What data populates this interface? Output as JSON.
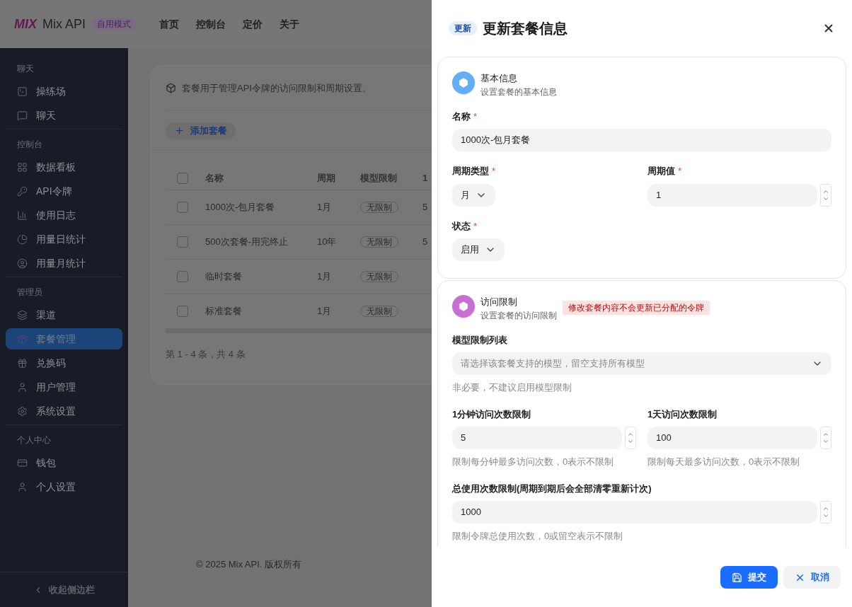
{
  "header": {
    "logo": "MIX",
    "brand": "Mix API",
    "mode_badge": "自用模式",
    "nav": [
      "首页",
      "控制台",
      "定价",
      "关于"
    ]
  },
  "sidebar": {
    "sections": [
      {
        "title": "聊天",
        "items": [
          {
            "label": "操练场",
            "selected": false
          },
          {
            "label": "聊天",
            "selected": false
          }
        ]
      },
      {
        "title": "控制台",
        "items": [
          {
            "label": "数据看板",
            "selected": false
          },
          {
            "label": "API令牌",
            "selected": false
          },
          {
            "label": "使用日志",
            "selected": false
          },
          {
            "label": "用量日统计",
            "selected": false
          },
          {
            "label": "用量月统计",
            "selected": false
          }
        ]
      },
      {
        "title": "管理员",
        "items": [
          {
            "label": "渠道",
            "selected": false
          },
          {
            "label": "套餐管理",
            "selected": true
          },
          {
            "label": "兑换码",
            "selected": false
          },
          {
            "label": "用户管理",
            "selected": false
          },
          {
            "label": "系统设置",
            "selected": false
          }
        ]
      },
      {
        "title": "个人中心",
        "items": [
          {
            "label": "钱包",
            "selected": false
          },
          {
            "label": "个人设置",
            "selected": false
          }
        ]
      }
    ],
    "collapse": "收起侧边栏"
  },
  "main": {
    "notice": "套餐用于管理API令牌的访问限制和周期设置。",
    "add_button": "添加套餐",
    "table": {
      "all_checked": false,
      "columns": [
        "名称",
        "周期",
        "模型限制",
        "1"
      ],
      "rows": [
        {
          "checked": false,
          "cells": [
            "1000次-包月套餐",
            "1月",
            "无限制",
            "5"
          ]
        },
        {
          "checked": false,
          "cells": [
            "500次套餐-用完终止",
            "10年",
            "无限制",
            "5"
          ]
        },
        {
          "checked": false,
          "cells": [
            "临时套餐",
            "1月",
            "无限制"
          ]
        },
        {
          "checked": false,
          "cells": [
            "标准套餐",
            "1月",
            "无限制"
          ]
        }
      ]
    },
    "pagination": "第 1 - 4 条，共 4 条"
  },
  "footer": "© 2025 Mix API. 版权所有",
  "drawer": {
    "required_mark": "*",
    "tag": "更新",
    "title": "更新套餐信息",
    "sections": [
      {
        "title": "基本信息",
        "subtitle": "设置套餐的基本信息",
        "color": "#64aef5",
        "rows": [
          [
            {
              "kind": "text",
              "label": "名称",
              "required": true,
              "value": "1000次-包月套餐"
            }
          ],
          [
            {
              "kind": "select",
              "label": "周期类型",
              "required": true,
              "value": "月"
            },
            {
              "kind": "number",
              "label": "周期值",
              "required": true,
              "value": "1"
            }
          ],
          [
            {
              "kind": "select",
              "label": "状态",
              "required": true,
              "value": "启用"
            }
          ]
        ]
      },
      {
        "title": "访问限制",
        "subtitle": "设置套餐的访问限制",
        "color": "#c86fd2",
        "warning": "修改套餐内容不会更新已分配的令牌",
        "rows": [
          [
            {
              "kind": "multiselect",
              "label": "模型限制列表",
              "required": false,
              "placeholder": "请选择该套餐支持的模型，留空支持所有模型",
              "help": "非必要，不建议启用模型限制"
            }
          ],
          [
            {
              "kind": "number",
              "label": "1分钟访问次数限制",
              "required": false,
              "value": "5",
              "help": "限制每分钟最多访问次数，0表示不限制"
            },
            {
              "kind": "number",
              "label": "1天访问次数限制",
              "required": false,
              "value": "100",
              "help": "限制每天最多访问次数，0表示不限制"
            }
          ],
          [
            {
              "kind": "number",
              "label": "总使用次数限制(周期到期后会全部清零重新计次)",
              "required": false,
              "value": "1000",
              "help": "限制令牌总使用次数，0或留空表示不限制"
            }
          ]
        ]
      }
    ],
    "buttons": [
      {
        "kind": "primary",
        "label": "提交"
      },
      {
        "kind": "secondary",
        "label": "取消"
      }
    ]
  }
}
